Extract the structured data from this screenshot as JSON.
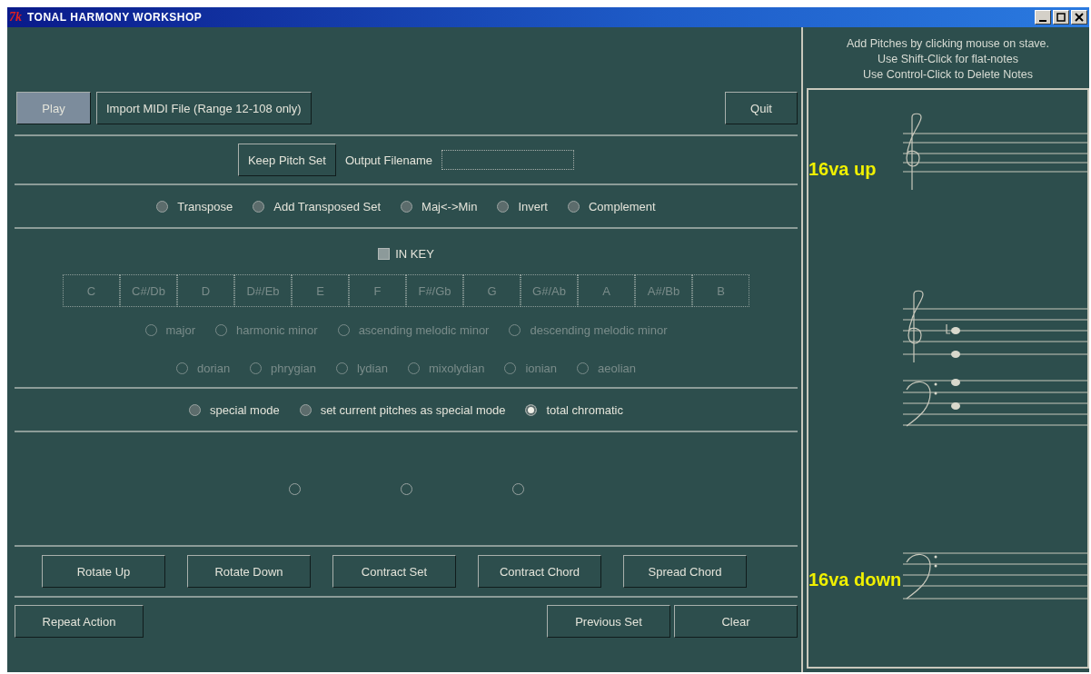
{
  "window": {
    "title": "TONAL HARMONY WORKSHOP",
    "app_badge": "7k"
  },
  "top_buttons": [
    {
      "label": "Play",
      "selected": true
    },
    {
      "label": "Import MIDI File (Range 12-108 only)",
      "selected": false
    }
  ],
  "quit": "Quit",
  "keep_pitch_set": "Keep Pitch Set",
  "output_filename": {
    "label": "Output Filename"
  },
  "operations": [
    {
      "label": "Transpose",
      "selected": false
    },
    {
      "label": "Add Transposed Set",
      "selected": false
    },
    {
      "label": "Maj<->Min",
      "selected": false
    },
    {
      "label": "Invert",
      "selected": false
    },
    {
      "label": "Complement",
      "selected": false
    }
  ],
  "in_key": {
    "label": "IN KEY",
    "checked": false
  },
  "keys": [
    {
      "label": "C",
      "disabled": true
    },
    {
      "label": "C#/Db",
      "disabled": true
    },
    {
      "label": "D",
      "disabled": true
    },
    {
      "label": "D#/Eb",
      "disabled": true
    },
    {
      "label": "E",
      "disabled": true
    },
    {
      "label": "F",
      "disabled": true
    },
    {
      "label": "F#/Gb",
      "disabled": true
    },
    {
      "label": "G",
      "disabled": true
    },
    {
      "label": "G#/Ab",
      "disabled": true
    },
    {
      "label": "A",
      "disabled": true
    },
    {
      "label": "A#/Bb",
      "disabled": true
    },
    {
      "label": "B",
      "disabled": true
    }
  ],
  "scales": [
    {
      "label": "major",
      "selected": false,
      "disabled": true
    },
    {
      "label": "harmonic minor",
      "selected": false,
      "disabled": true
    },
    {
      "label": "ascending melodic minor",
      "selected": false,
      "disabled": true
    },
    {
      "label": "descending melodic minor",
      "selected": false,
      "disabled": true
    }
  ],
  "modes": [
    {
      "label": "dorian",
      "selected": false,
      "disabled": true
    },
    {
      "label": "phrygian",
      "selected": false,
      "disabled": true
    },
    {
      "label": "lydian",
      "selected": false,
      "disabled": true
    },
    {
      "label": "mixolydian",
      "selected": false,
      "disabled": true
    },
    {
      "label": "ionian",
      "selected": false,
      "disabled": true
    },
    {
      "label": "aeolian",
      "selected": false,
      "disabled": true
    }
  ],
  "special": [
    {
      "label": "special mode",
      "selected": false
    },
    {
      "label": "set current pitches as special mode",
      "selected": false
    },
    {
      "label": "total chromatic",
      "selected": true
    }
  ],
  "unlabeled_options": [
    {
      "selected": false
    },
    {
      "selected": false
    },
    {
      "selected": false
    }
  ],
  "transform_buttons": [
    "Rotate Up",
    "Rotate Down",
    "Contract Set",
    "Contract Chord",
    "Spread Chord"
  ],
  "bottom_left_buttons": [
    "Repeat Action"
  ],
  "bottom_right_buttons": [
    "Previous Set",
    "Clear"
  ],
  "instructions": [
    "Add Pitches by clicking mouse on stave.",
    "Use Shift-Click for flat-notes",
    "Use Control-Click to Delete Notes"
  ],
  "staff": {
    "upper_label": "16va up",
    "lower_label": "16va down"
  }
}
